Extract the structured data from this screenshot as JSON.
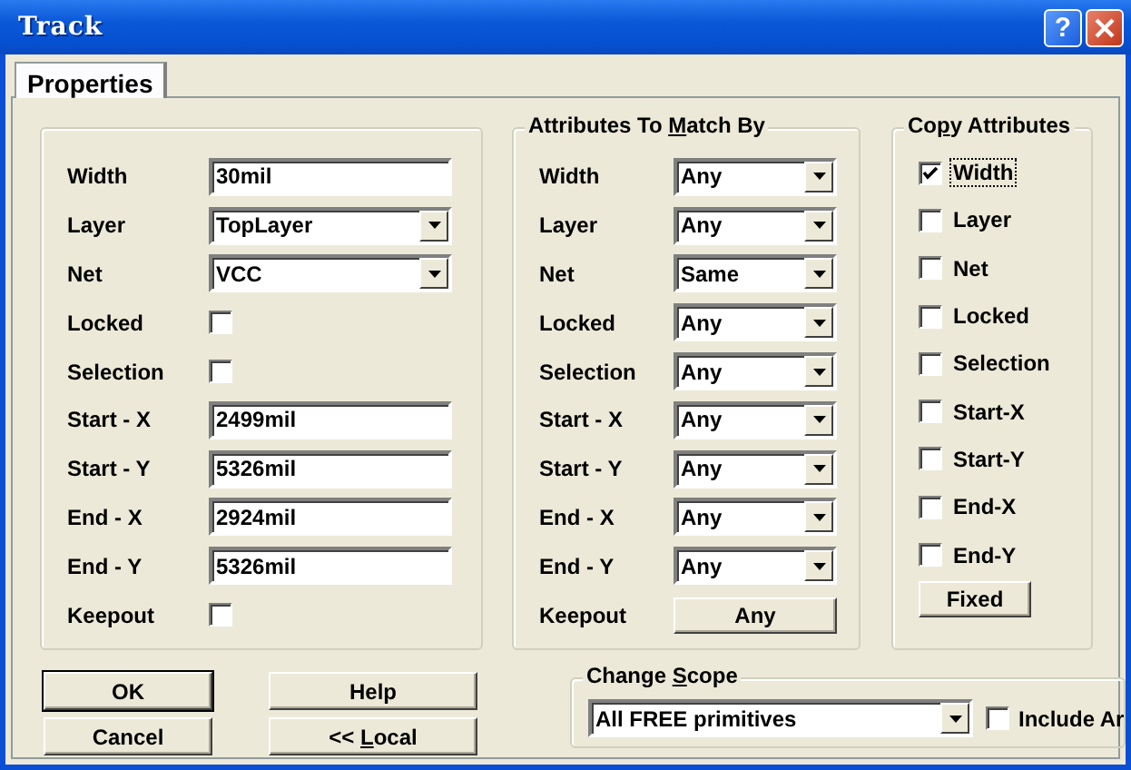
{
  "window": {
    "title": "Track",
    "controls": [
      {
        "kind": "help",
        "label": "?"
      },
      {
        "kind": "close"
      }
    ]
  },
  "tabs": [
    {
      "label": "Properties",
      "selected": true
    }
  ],
  "properties": [
    {
      "kind": "text",
      "label": "Width",
      "value": "30mil"
    },
    {
      "kind": "combo",
      "label": "Layer",
      "value": "TopLayer"
    },
    {
      "kind": "combo",
      "label": "Net",
      "value": "VCC"
    },
    {
      "kind": "check",
      "label": "Locked",
      "checked": false
    },
    {
      "kind": "check",
      "label": "Selection",
      "checked": false
    },
    {
      "kind": "text",
      "label": "Start - X",
      "value": "2499mil"
    },
    {
      "kind": "text",
      "label": "Start - Y",
      "value": "5326mil"
    },
    {
      "kind": "text",
      "label": "End - X",
      "value": "2924mil"
    },
    {
      "kind": "text",
      "label": "End - Y",
      "value": "5326mil"
    },
    {
      "kind": "check",
      "label": "Keepout",
      "checked": false
    }
  ],
  "match": {
    "title": [
      {
        "text": "Attributes To "
      },
      {
        "text": "M",
        "accel": true
      },
      {
        "text": "atch By"
      }
    ],
    "rows": [
      {
        "kind": "combo",
        "label": "Width",
        "value": "Any"
      },
      {
        "kind": "combo",
        "label": "Layer",
        "value": "Any"
      },
      {
        "kind": "combo",
        "label": "Net",
        "value": "Same"
      },
      {
        "kind": "combo",
        "label": "Locked",
        "value": "Any"
      },
      {
        "kind": "combo",
        "label": "Selection",
        "value": "Any"
      },
      {
        "kind": "combo",
        "label": "Start - X",
        "value": "Any"
      },
      {
        "kind": "combo",
        "label": "Start - Y",
        "value": "Any"
      },
      {
        "kind": "combo",
        "label": "End - X",
        "value": "Any"
      },
      {
        "kind": "combo",
        "label": "End - Y",
        "value": "Any"
      },
      {
        "kind": "button",
        "label": "Keepout",
        "value": "Any"
      }
    ]
  },
  "copy": {
    "title": [
      {
        "text": "Co"
      },
      {
        "text": "p",
        "accel": true
      },
      {
        "text": "y Attributes"
      }
    ],
    "items": [
      {
        "label": "Width",
        "checked": true,
        "focused": true
      },
      {
        "label": "Layer",
        "checked": false,
        "focused": false
      },
      {
        "label": "Net",
        "checked": false,
        "focused": false
      },
      {
        "label": "Locked",
        "checked": false,
        "focused": false
      },
      {
        "label": "Selection",
        "checked": false,
        "focused": false
      },
      {
        "label": "Start-X",
        "checked": false,
        "focused": false
      },
      {
        "label": "Start-Y",
        "checked": false,
        "focused": false
      },
      {
        "label": "End-X",
        "checked": false,
        "focused": false
      },
      {
        "label": "End-Y",
        "checked": false,
        "focused": false
      }
    ],
    "button": "Fixed"
  },
  "buttons": [
    {
      "label": [
        {
          "text": "OK"
        }
      ],
      "default": true
    },
    {
      "label": [
        {
          "text": "Help"
        }
      ],
      "default": false
    },
    {
      "label": [
        {
          "text": "Cancel"
        }
      ],
      "default": false
    },
    {
      "label": [
        {
          "text": "<< "
        },
        {
          "text": "L",
          "accel": true
        },
        {
          "text": "ocal"
        }
      ],
      "default": false
    }
  ],
  "scope": {
    "title": [
      {
        "text": "Change "
      },
      {
        "text": "S",
        "accel": true
      },
      {
        "text": "cope"
      }
    ],
    "value": "All FREE primitives",
    "include": {
      "label": "Include Ar",
      "checked": false
    }
  }
}
